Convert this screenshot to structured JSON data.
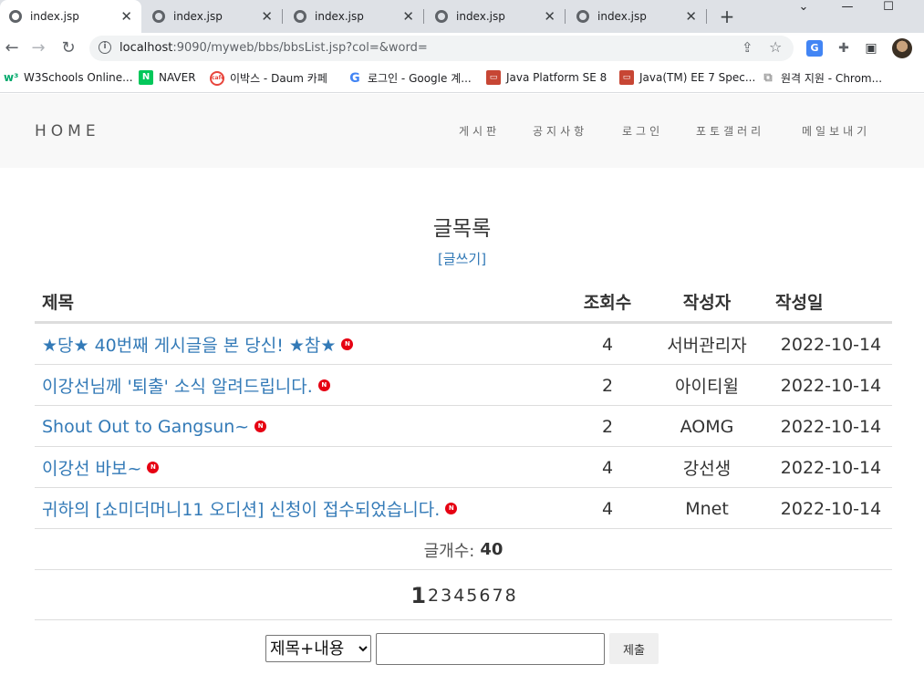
{
  "browser": {
    "tabs": [
      {
        "title": "index.jsp",
        "active": true
      },
      {
        "title": "index.jsp",
        "active": false
      },
      {
        "title": "index.jsp",
        "active": false
      },
      {
        "title": "index.jsp",
        "active": false
      },
      {
        "title": "index.jsp",
        "active": false
      }
    ],
    "new_tab": "+",
    "url_host": "localhost",
    "url_path": ":9090/myweb/bbs/bbsList.jsp?col=&word=",
    "bookmarks": [
      {
        "label": "W3Schools Online...",
        "icon": "w3schools-icon",
        "color": "#04aa6d"
      },
      {
        "label": "NAVER",
        "icon": "naver-icon",
        "color": "#03c75a"
      },
      {
        "label": "이박스 - Daum 카페",
        "icon": "daum-cafe-icon",
        "color": "#e8453c"
      },
      {
        "label": "로그인 - Google 계...",
        "icon": "google-icon",
        "color": "#4285f4"
      },
      {
        "label": "Java Platform SE 8",
        "icon": "oracle-icon",
        "color": "#c74634"
      },
      {
        "label": "Java(TM) EE 7 Spec...",
        "icon": "oracle-icon",
        "color": "#c74634"
      },
      {
        "label": "원격 지원 - Chrom...",
        "icon": "remote-desktop-icon",
        "color": "#9e9e9e"
      }
    ]
  },
  "site": {
    "brand": "HOME",
    "menu": [
      "게시판",
      "공지사항",
      "로그인",
      "포토갤러리",
      "메일보내기"
    ]
  },
  "board": {
    "title": "글목록",
    "write_link": "[글쓰기]",
    "columns": {
      "title": "제목",
      "views": "조회수",
      "writer": "작성자",
      "date": "작성일"
    },
    "rows": [
      {
        "title": "★당★ 40번째 게시글을 본 당신! ★참★",
        "views": "4",
        "writer": "서버관리자",
        "date": "2022-10-14",
        "new": "N"
      },
      {
        "title": "이강선님께 '퇴출' 소식 알려드립니다.",
        "views": "2",
        "writer": "아이티윌",
        "date": "2022-10-14",
        "new": "N"
      },
      {
        "title": "Shout Out to Gangsun~",
        "views": "2",
        "writer": "AOMG",
        "date": "2022-10-14",
        "new": "N"
      },
      {
        "title": "이강선 바보~",
        "views": "4",
        "writer": "강선생",
        "date": "2022-10-14",
        "new": "N"
      },
      {
        "title": "귀하의 [쇼미더머니11 오디션] 신청이 접수되었습니다.",
        "views": "4",
        "writer": "Mnet",
        "date": "2022-10-14",
        "new": "N"
      }
    ],
    "count_label": "글개수:",
    "count_value": "40",
    "pages": [
      "1",
      "2",
      "3",
      "4",
      "5",
      "6",
      "7",
      "8"
    ],
    "current_page": "1",
    "search": {
      "selected_option": "제목+내용",
      "query": "",
      "submit_label": "제출"
    }
  },
  "colors": {
    "link": "#337ab7",
    "navbar_bg": "#f8f8f8",
    "new_badge": "#e60012"
  }
}
